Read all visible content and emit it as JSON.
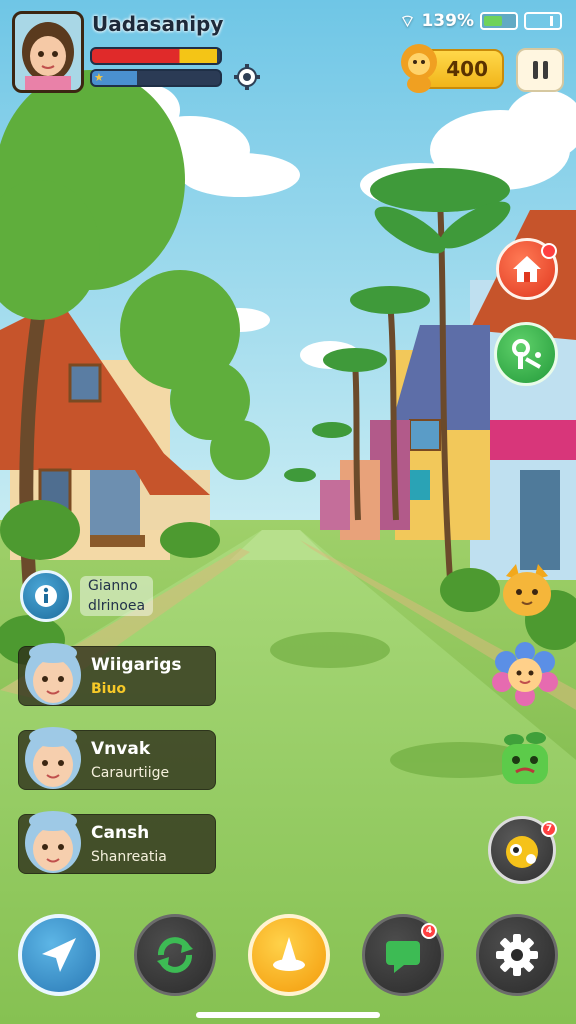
{
  "player": {
    "name": "Uadasanipy",
    "hp_fraction": 0.98,
    "xp_fraction": 0.35
  },
  "status_bar": {
    "battery_text": "139%"
  },
  "currency": {
    "coins": "400"
  },
  "hint": {
    "line1": "Gianno",
    "line2": "dlrinoea"
  },
  "npcs": [
    {
      "name": "Wiigarigs",
      "subtitle": "Biuo",
      "subtitle_color": "#f7c928"
    },
    {
      "name": "Vnvak",
      "subtitle": "Caraurtiige",
      "subtitle_color": "#f5f0dc"
    },
    {
      "name": "Cansh",
      "subtitle": "Shanreatia",
      "subtitle_color": "#f5f0dc"
    }
  ],
  "badges": {
    "home": "",
    "fab": "7",
    "chat": "4"
  },
  "icons": {
    "player_avatar": "girl-portrait",
    "settings_small": "gear-icon",
    "coin_pet": "lion-pet-icon",
    "pause": "pause-icon",
    "home": "house-icon",
    "tool": "watering-can-icon",
    "hint": "info-icon",
    "fab": "critter-fab-icon",
    "nav": [
      "navigate-arrow-icon",
      "refresh-cycle-icon",
      "magic-hat-icon",
      "chat-bubble-icon",
      "gear-icon"
    ]
  },
  "colors": {
    "sky": "#8fd0e8",
    "grass": "#8bc34a",
    "coin": "#f1b51a",
    "home_btn": "#e0381f",
    "tool_btn": "#239a3a",
    "primary_nav": "#2a79b5"
  }
}
